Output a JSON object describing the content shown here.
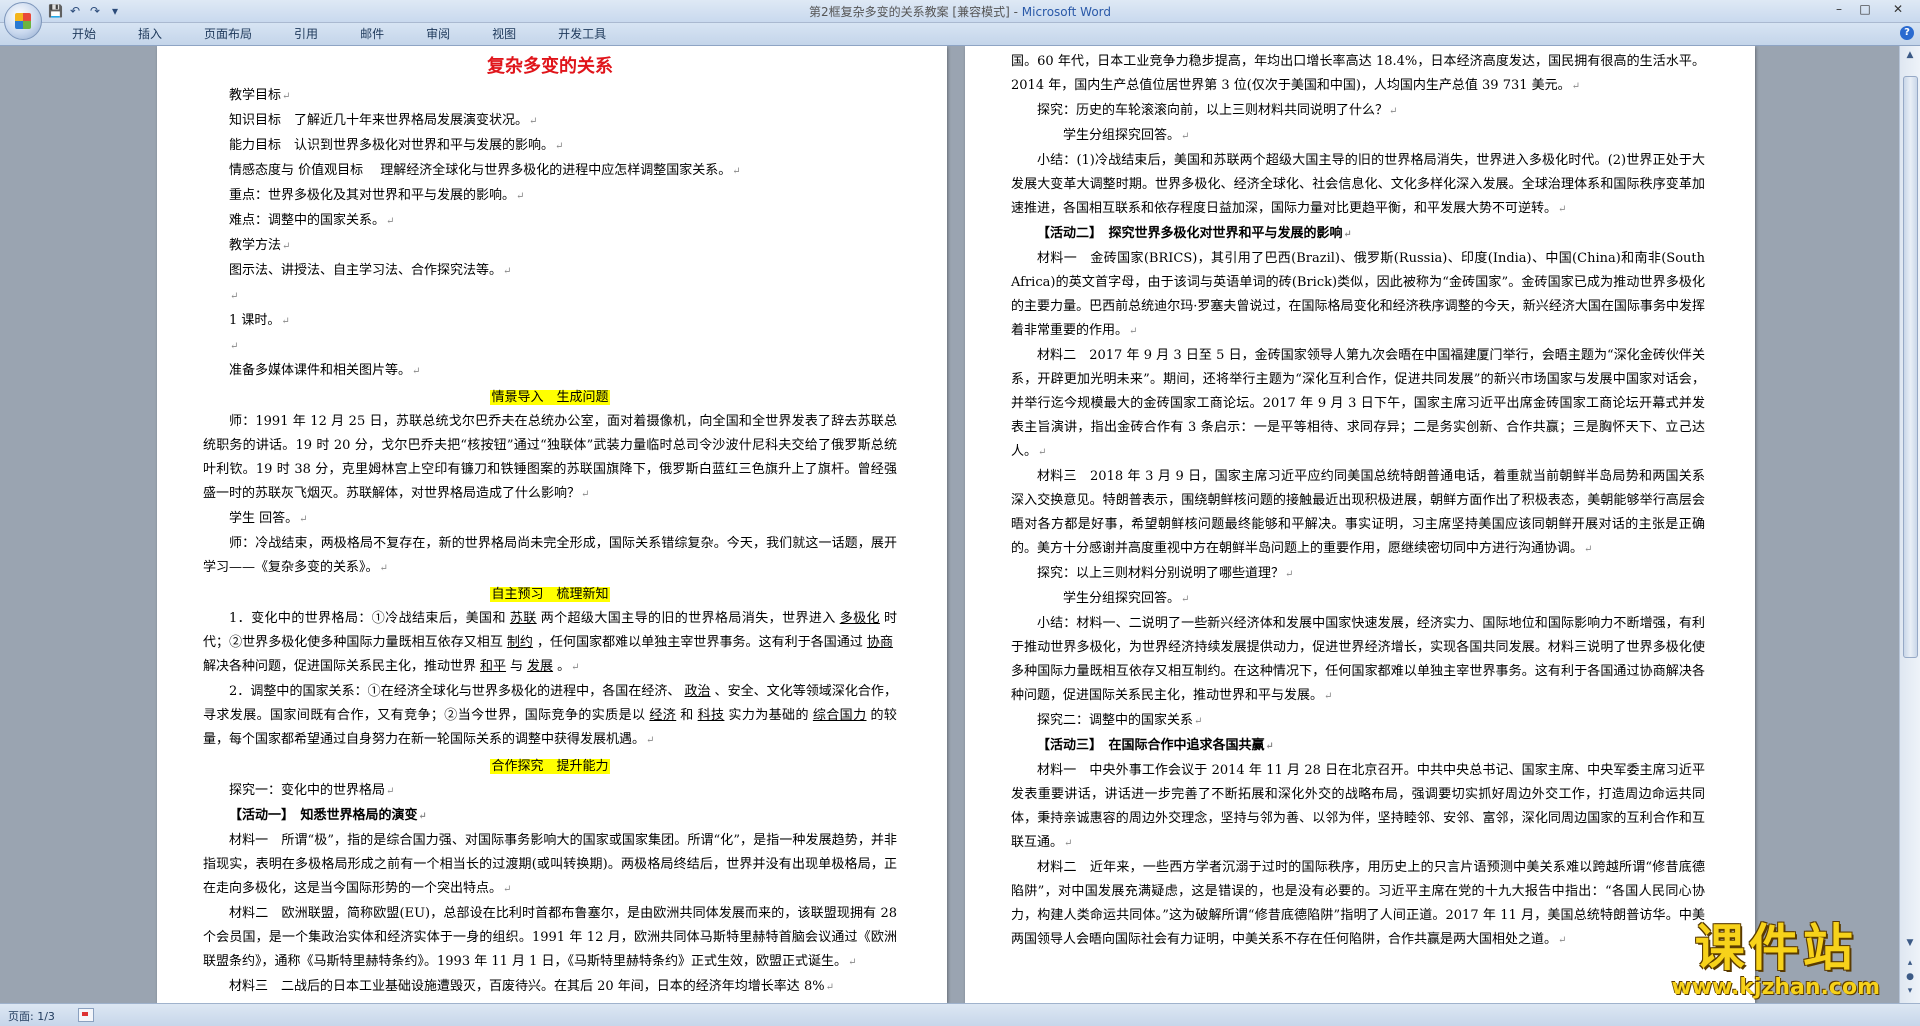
{
  "window": {
    "title_doc": "第2框复杂多变的关系教案 [兼容模式]",
    "title_sep": " - ",
    "title_app": "Microsoft Word"
  },
  "ribbon": {
    "tabs": [
      "开始",
      "插入",
      "页面布局",
      "引用",
      "邮件",
      "审阅",
      "视图",
      "开发工具"
    ]
  },
  "status": {
    "page": "页面: 1/3"
  },
  "left_page": {
    "title": "复杂多变的关系",
    "lines": [
      {
        "t": "教学目标",
        "c": "i2"
      },
      {
        "t": "知识目标　了解近几十年来世界格局发展演变状况。",
        "c": "i2"
      },
      {
        "t": "能力目标　认识到世界多极化对世界和平与发展的影响。",
        "c": "i2"
      },
      {
        "t": "情感态度与 价值观目标　 理解经济全球化与世界多极化的进程中应怎样调整国家关系。",
        "c": "i2"
      },
      {
        "t": "重点：世界多极化及其对世界和平与发展的影响。",
        "c": "i2"
      },
      {
        "t": "难点：调整中的国家关系。",
        "c": "i2"
      },
      {
        "t": "教学方法",
        "c": "i2"
      },
      {
        "t": "图示法、讲授法、自主学习法、合作探究法等。",
        "c": "i2"
      },
      {
        "t": "",
        "c": "i2"
      },
      {
        "t": "1 课时。",
        "c": "i2"
      },
      {
        "t": "",
        "c": "i2"
      },
      {
        "t": "准备多媒体课件和相关图片等。",
        "c": "i2"
      }
    ],
    "heading1": "情景导入　生成问题",
    "para1": [
      {
        "t": "师：1991 年 12 月 25 日，苏联总统戈尔巴乔夫在总统办公室，面对着摄像机，向全国和全世界发表了辞去苏联总统职务的讲话。19 时 20 分，戈尔巴乔夫把“核按钮”通过“独联体”武装力量临时总司令沙波什尼科夫交给了俄罗斯总统叶利钦。19 时 38 分，克里姆林宫上空印有镰刀和铁锤图案的苏联国旗降下，俄罗斯白蓝红三色旗升上了旗杆。曾经强盛一时的苏联灰飞烟灭。苏联解体，对世界格局造成了什么影响？",
        "c": "i2"
      },
      {
        "t": "学生 回答。",
        "c": "i2"
      },
      {
        "t": "师：冷战结束，两极格局不复存在，新的世界格局尚未完全形成，国际关系错综复杂。今天，我们就这一话题，展开学习——《复杂多变的关系》。",
        "c": "i2"
      }
    ],
    "heading2": "自主预习　梳理新知",
    "review": {
      "p1_a": "1．变化中的世界格局：①冷战结束后，美国和",
      "p1_b1": "苏联",
      "p1_c": "两个超级大国主导的旧的世界格局消失，世界进入",
      "p1_b2": "多极化",
      "p1_d": "时代；②世界多极化使多种国际力量既相互依存又相互",
      "p1_b3": "制约",
      "p1_e": "，任何国家都难以单独主宰世界事务。这有利于各国通过",
      "p1_b4": "协商",
      "p1_f": "解决各种问题，促进国际关系民主化，推动世界",
      "p1_b5": "和平",
      "p1_g": "与",
      "p1_b6": "发展",
      "p1_h": "。",
      "p2_a": "2．调整中的国家关系：①在经济全球化与世界多极化的进程中，各国在经济、",
      "p2_b1": "政治",
      "p2_c": "、安全、文化等领域深化合作，寻求发展。国家间既有合作，又有竞争；②当今世界，国际竞争的实质是以",
      "p2_b2": "经济",
      "p2_d": "和",
      "p2_b3": "科技",
      "p2_e": "实力为基础的",
      "p2_b4": "综合国力",
      "p2_f": "的较量，每个国家都希望通过自身努力在新一轮国际关系的调整中获得发展机遇。"
    },
    "heading3": "合作探究　提升能力",
    "para3": [
      {
        "t": "探究一：变化中的世界格局",
        "c": "i2"
      },
      {
        "t": "【活动一】　知悉世界格局的演变",
        "c": "i2 bold"
      },
      {
        "t": "材料一　所谓“极”，指的是综合国力强、对国际事务影响大的国家或国家集团。所谓“化”，是指一种发展趋势，并非指现实，表明在多极格局形成之前有一个相当长的过渡期(或叫转换期)。两极格局终结后，世界并没有出现单极格局，正在走向多极化，这是当今国际形势的一个突出特点。",
        "c": "i2"
      },
      {
        "t": "材料二　欧洲联盟，简称欧盟(EU)，总部设在比利时首都布鲁塞尔，是由欧洲共同体发展而来的，该联盟现拥有 28 个会员国，是一个集政治实体和经济实体于一身的组织。1991 年 12 月，欧洲共同体马斯特里赫特首脑会议通过《欧洲联盟条约》，通称《马斯特里赫特条约》。1993 年 11 月 1 日，《马斯特里赫特条约》正式生效，欧盟正式诞生。",
        "c": "i2"
      },
      {
        "t": "材料三　二战后的日本工业基础设施遭毁灭，百废待兴。在其后 20 年间，日本的经济年均增长率达 8%",
        "c": "i2"
      }
    ]
  },
  "right_page": {
    "lines": [
      {
        "t": "国。60 年代，日本工业竞争力稳步提高，年均出口增长率高达 18.4%，日本经济高度发达，国民拥有很高的生活水平。2014 年，国内生产总值位居世界第 3 位(仅次于美国和中国)，人均国内生产总值 39 731 美元。",
        "c": ""
      },
      {
        "t": "探究：历史的车轮滚滚向前，以上三则材料共同说明了什么？",
        "c": "i2"
      },
      {
        "t": "学生分组探究回答。",
        "c": "i3"
      },
      {
        "t": "小结：(1)冷战结束后，美国和苏联两个超级大国主导的旧的世界格局消失，世界进入多极化时代。(2)世界正处于大发展大变革大调整时期。世界多极化、经济全球化、社会信息化、文化多样化深入发展。全球治理体系和国际秩序变革加速推进，各国相互联系和依存程度日益加深，国际力量对比更趋平衡，和平发展大势不可逆转。",
        "c": "i2"
      },
      {
        "t": "【活动二】　探究世界多极化对世界和平与发展的影响",
        "c": "i2 bold"
      },
      {
        "t": "材料一　金砖国家(BRICS)，其引用了巴西(Brazil)、俄罗斯(Russia)、印度(India)、中国(China)和南非(South Africa)的英文首字母，由于该词与英语单词的砖(Brick)类似，因此被称为“金砖国家”。金砖国家已成为推动世界多极化的主要力量。巴西前总统迪尔玛·罗塞夫曾说过，在国际格局变化和经济秩序调整的今天，新兴经济大国在国际事务中发挥着非常重要的作用。",
        "c": "i2"
      },
      {
        "t": "材料二　2017 年 9 月 3 日至 5 日，金砖国家领导人第九次会晤在中国福建厦门举行，会晤主题为“深化金砖伙伴关系，开辟更加光明未来”。期间，还将举行主题为“深化互利合作，促进共同发展”的新兴市场国家与发展中国家对话会，并举行迄今规模最大的金砖国家工商论坛。2017 年 9 月 3 日下午，国家主席习近平出席金砖国家工商论坛开幕式并发表主旨演讲，指出金砖合作有 3 条启示：一是平等相待、求同存异；二是务实创新、合作共赢；三是胸怀天下、立己达人。",
        "c": "i2"
      },
      {
        "t": "材料三　2018 年 3 月 9 日，国家主席习近平应约同美国总统特朗普通电话，着重就当前朝鲜半岛局势和两国关系深入交换意见。特朗普表示，围绕朝鲜核问题的接触最近出现积极进展，朝鲜方面作出了积极表态，美朝能够举行高层会晤对各方都是好事，希望朝鲜核问题最终能够和平解决。事实证明，习主席坚持美国应该同朝鲜开展对话的主张是正确的。美方十分感谢并高度重视中方在朝鲜半岛问题上的重要作用，愿继续密切同中方进行沟通协调。",
        "c": "i2"
      },
      {
        "t": "探究：以上三则材料分别说明了哪些道理？",
        "c": "i2"
      },
      {
        "t": "学生分组探究回答。",
        "c": "i3"
      },
      {
        "t": "小结：材料一、二说明了一些新兴经济体和发展中国家快速发展，经济实力、国际地位和国际影响力不断增强，有利于推动世界多极化，为世界经济持续发展提供动力，促进世界经济增长，实现各国共同发展。材料三说明了世界多极化使多种国际力量既相互依存又相互制约。在这种情况下，任何国家都难以单独主宰世界事务。这有利于各国通过协商解决各种问题，促进国际关系民主化，推动世界和平与发展。",
        "c": "i2"
      },
      {
        "t": "探究二：调整中的国家关系",
        "c": "i2"
      },
      {
        "t": "【活动三】　在国际合作中追求各国共赢",
        "c": "i2 bold"
      },
      {
        "t": "材料一　中央外事工作会议于 2014 年 11 月 28 日在北京召开。中共中央总书记、国家主席、中央军委主席习近平发表重要讲话，讲话进一步完善了不断拓展和深化外交的战略布局，强调要切实抓好周边外交工作，打造周边命运共同体，秉持亲诚惠容的周边外交理念，坚持与邻为善、以邻为伴，坚持睦邻、安邻、富邻，深化同周边国家的互利合作和互联互通。",
        "c": "i2"
      },
      {
        "t": "材料二　近年来，一些西方学者沉溺于过时的国际秩序，用历史上的只言片语预测中美关系难以跨越所谓“修昔底德陷阱”，对中国发展充满疑虑，这是错误的，也是没有必要的。习近平主席在党的十九大报告中指出：“各国人民同心协力，构建人类命运共同体。”这为破解所谓“修昔底德陷阱”指明了人间正道。2017 年 11 月，美国总统特朗普访华。中美两国领导人会晤向国际社会有力证明，中美关系不存在任何陷阱，合作共赢是两大国相处之道。",
        "c": "i2"
      }
    ]
  },
  "watermark": {
    "title": "课件站",
    "url": "www.kjzhan.com"
  }
}
